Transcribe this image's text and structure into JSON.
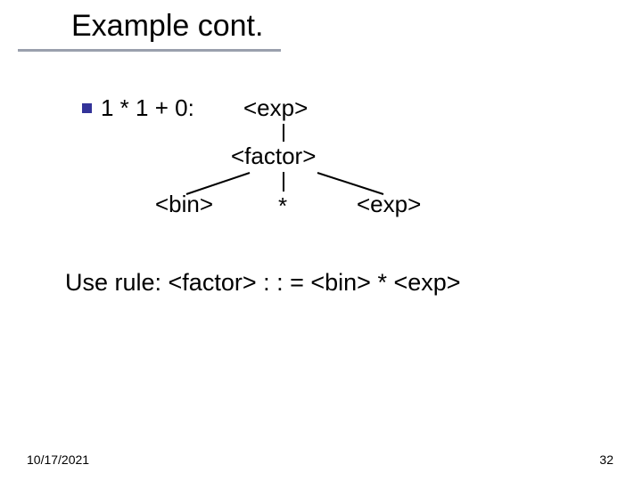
{
  "title": "Example cont.",
  "bullet_input": "1 * 1 + 0:",
  "tree": {
    "exp_top": "<exp>",
    "factor": "<factor>",
    "bin": "<bin>",
    "star": "*",
    "exp_right": "<exp>"
  },
  "rule_text": "Use rule:  <factor>  : : =  <bin> *  <exp>",
  "footer": {
    "date": "10/17/2021",
    "page": "32"
  },
  "colors": {
    "bullet": "#333399",
    "underline": "#9aa0ad"
  }
}
